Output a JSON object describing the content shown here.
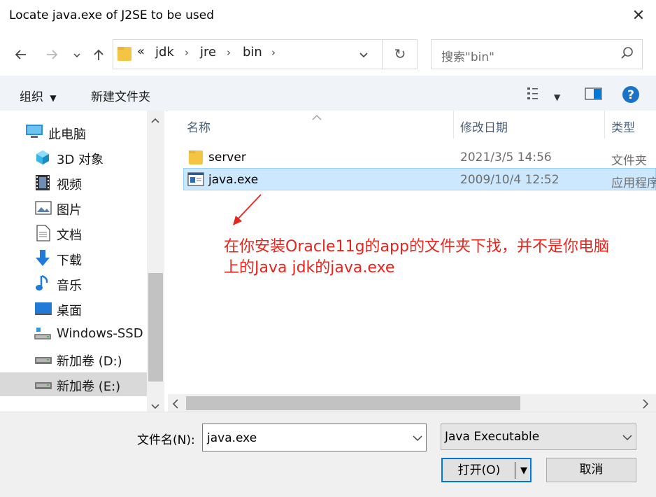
{
  "window": {
    "title": "Locate java.exe of J2SE to be used"
  },
  "address_bar": {
    "overflow": "«",
    "breadcrumbs": [
      "jdk",
      "jre",
      "bin"
    ],
    "search_placeholder": "搜索\"bin\""
  },
  "toolbar": {
    "organize_label": "组织",
    "new_folder_label": "新建文件夹"
  },
  "sidebar": {
    "items": [
      {
        "label": "此电脑",
        "icon": "computer-icon"
      },
      {
        "label": "3D 对象",
        "icon": "3d-objects-icon"
      },
      {
        "label": "视频",
        "icon": "video-icon"
      },
      {
        "label": "图片",
        "icon": "pictures-icon"
      },
      {
        "label": "文档",
        "icon": "documents-icon"
      },
      {
        "label": "下载",
        "icon": "download-icon"
      },
      {
        "label": "音乐",
        "icon": "music-icon"
      },
      {
        "label": "桌面",
        "icon": "desktop-icon"
      },
      {
        "label": "Windows-SSD",
        "icon": "drive-icon"
      },
      {
        "label": "新加卷 (D:)",
        "icon": "drive-icon"
      },
      {
        "label": "新加卷 (E:)",
        "icon": "drive-icon",
        "selected": true
      }
    ]
  },
  "file_list": {
    "columns": {
      "name": "名称",
      "date": "修改日期",
      "type": "类型"
    },
    "rows": [
      {
        "name": "server",
        "date": "2021/3/5 14:56",
        "type": "文件夹",
        "icon": "folder-icon"
      },
      {
        "name": "java.exe",
        "date": "2009/10/4 12:52",
        "type": "应用程序",
        "icon": "exe-icon",
        "selected": true
      }
    ]
  },
  "annotation": {
    "line1": "在你安装Oracle11g的app的文件夹下找，并不是你电脑",
    "line2": "上的Java jdk的java.exe"
  },
  "footer": {
    "filename_label": "文件名(N):",
    "filename_value": "java.exe",
    "filetype_value": "Java Executable",
    "open_label": "打开(O)",
    "cancel_label": "取消"
  },
  "colors": {
    "accent": "#0078d7",
    "selection": "#cce8ff",
    "annotation": "#e8241c",
    "help": "#1a73c8",
    "folder": "#f4c542"
  }
}
